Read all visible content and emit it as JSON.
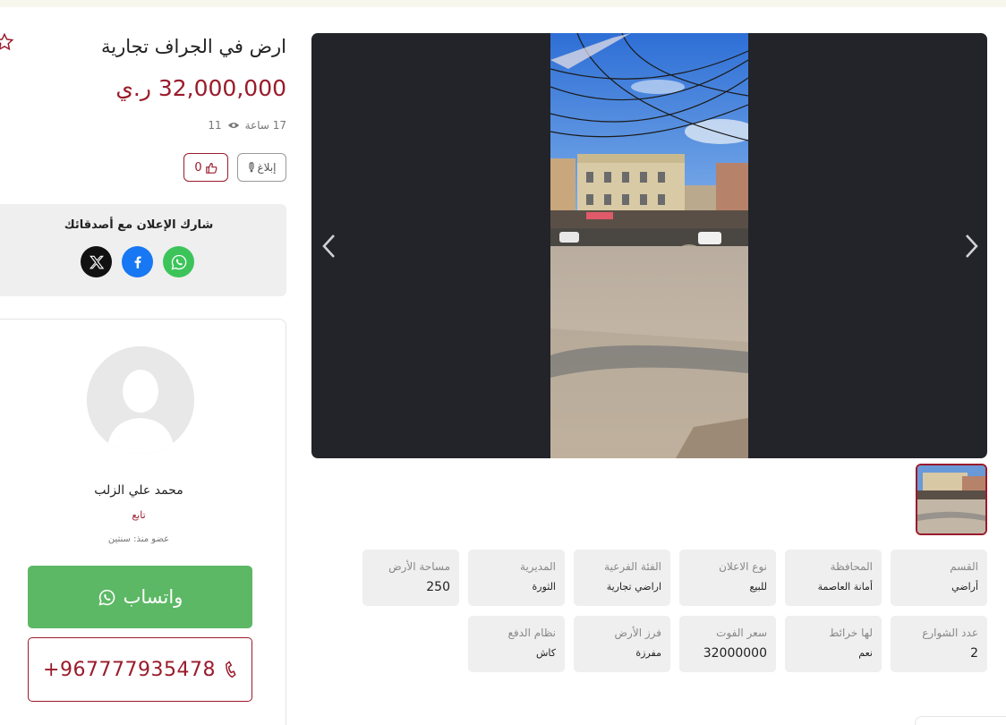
{
  "listing": {
    "title": "ارض في الجراف تجارية",
    "price": "32,000,000 ر.ي",
    "time_ago": "17 ساعة",
    "views": "11",
    "report_label": "إبلاغ",
    "likes": "0"
  },
  "share": {
    "title": "شارك الإعلان مع أصدقائك",
    "networks": [
      "x-icon",
      "facebook-icon",
      "whatsapp-icon"
    ]
  },
  "seller": {
    "name": "محمد علي الزلب",
    "role": "تابع",
    "member_since": "عضو منذ: سنتين",
    "whatsapp_label": "واتساب",
    "phone": "+967777935478"
  },
  "specs": [
    {
      "label": "القسم",
      "value": "أراضي"
    },
    {
      "label": "المحافظة",
      "value": "أمانة العاصمة"
    },
    {
      "label": "نوع الاعلان",
      "value": "للبيع"
    },
    {
      "label": "الفئة الفرعية",
      "value": "اراضي تجارية"
    },
    {
      "label": "المديرية",
      "value": "الثورة"
    },
    {
      "label": "مساحة الأرض",
      "value": "250"
    },
    {
      "label": "عدد الشوارع",
      "value": "2"
    },
    {
      "label": "لها خرائط",
      "value": "نعم"
    },
    {
      "label": "سعر الفوت",
      "value": "32000000"
    },
    {
      "label": "فرز الأرض",
      "value": "مفرزة"
    },
    {
      "label": "نظام الدفع",
      "value": "كاش"
    }
  ],
  "colors": {
    "brand": "#9a1b2b",
    "whatsapp": "#5cb865",
    "gallery_bg": "#222429",
    "spec_bg": "#efefef"
  }
}
